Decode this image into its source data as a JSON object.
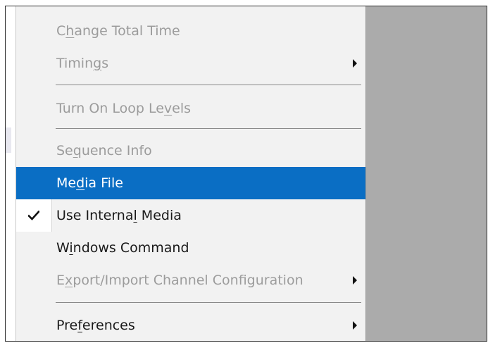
{
  "menu": {
    "items": [
      {
        "pre": "C",
        "u": "h",
        "post": "ange Total Time",
        "disabled": true,
        "submenu": false
      },
      {
        "pre": "Timin",
        "u": "g",
        "post": "s",
        "disabled": true,
        "submenu": true
      },
      {
        "pre": "Turn On Loop Le",
        "u": "v",
        "post": "els",
        "disabled": true,
        "submenu": false
      },
      {
        "pre": "Se",
        "u": "q",
        "post": "uence Info",
        "disabled": true,
        "submenu": false
      },
      {
        "pre": "Me",
        "u": "d",
        "post": "ia File",
        "disabled": false,
        "submenu": false,
        "highlighted": true
      },
      {
        "pre": "Use Interna",
        "u": "l",
        "post": " Media",
        "disabled": false,
        "submenu": false,
        "checked": true
      },
      {
        "pre": "W",
        "u": "i",
        "post": "ndows Command",
        "disabled": false,
        "submenu": false
      },
      {
        "pre": "E",
        "u": "x",
        "post": "port/Import Channel Configuration",
        "disabled": true,
        "submenu": true
      },
      {
        "pre": "Pre",
        "u": "f",
        "post": "erences",
        "disabled": false,
        "submenu": true
      }
    ]
  },
  "colors": {
    "highlight": "#0a6ec4",
    "disabled_text": "#9c9c9c",
    "menu_bg": "#f2f2f2",
    "app_bg": "#ababab"
  },
  "icons": {
    "check": "check-icon",
    "submenu": "submenu-arrow-icon"
  }
}
